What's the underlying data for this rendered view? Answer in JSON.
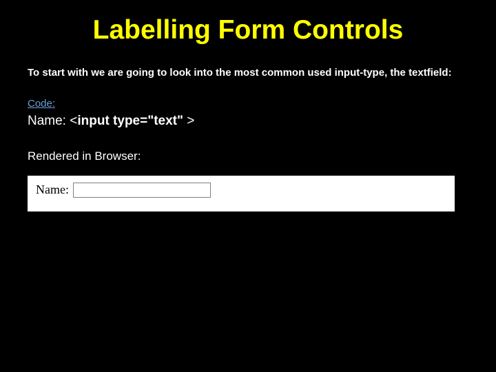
{
  "title": "Labelling Form Controls",
  "intro": "To start with we are going to look into the most common used input-type, the textfield:",
  "code_label": "Code:",
  "code": {
    "prefix": "Name: <",
    "bold": "input type=\"text\" ",
    "suffix": ">"
  },
  "rendered_label": "Rendered in Browser:",
  "rendered_name": "Name:",
  "input_value": ""
}
